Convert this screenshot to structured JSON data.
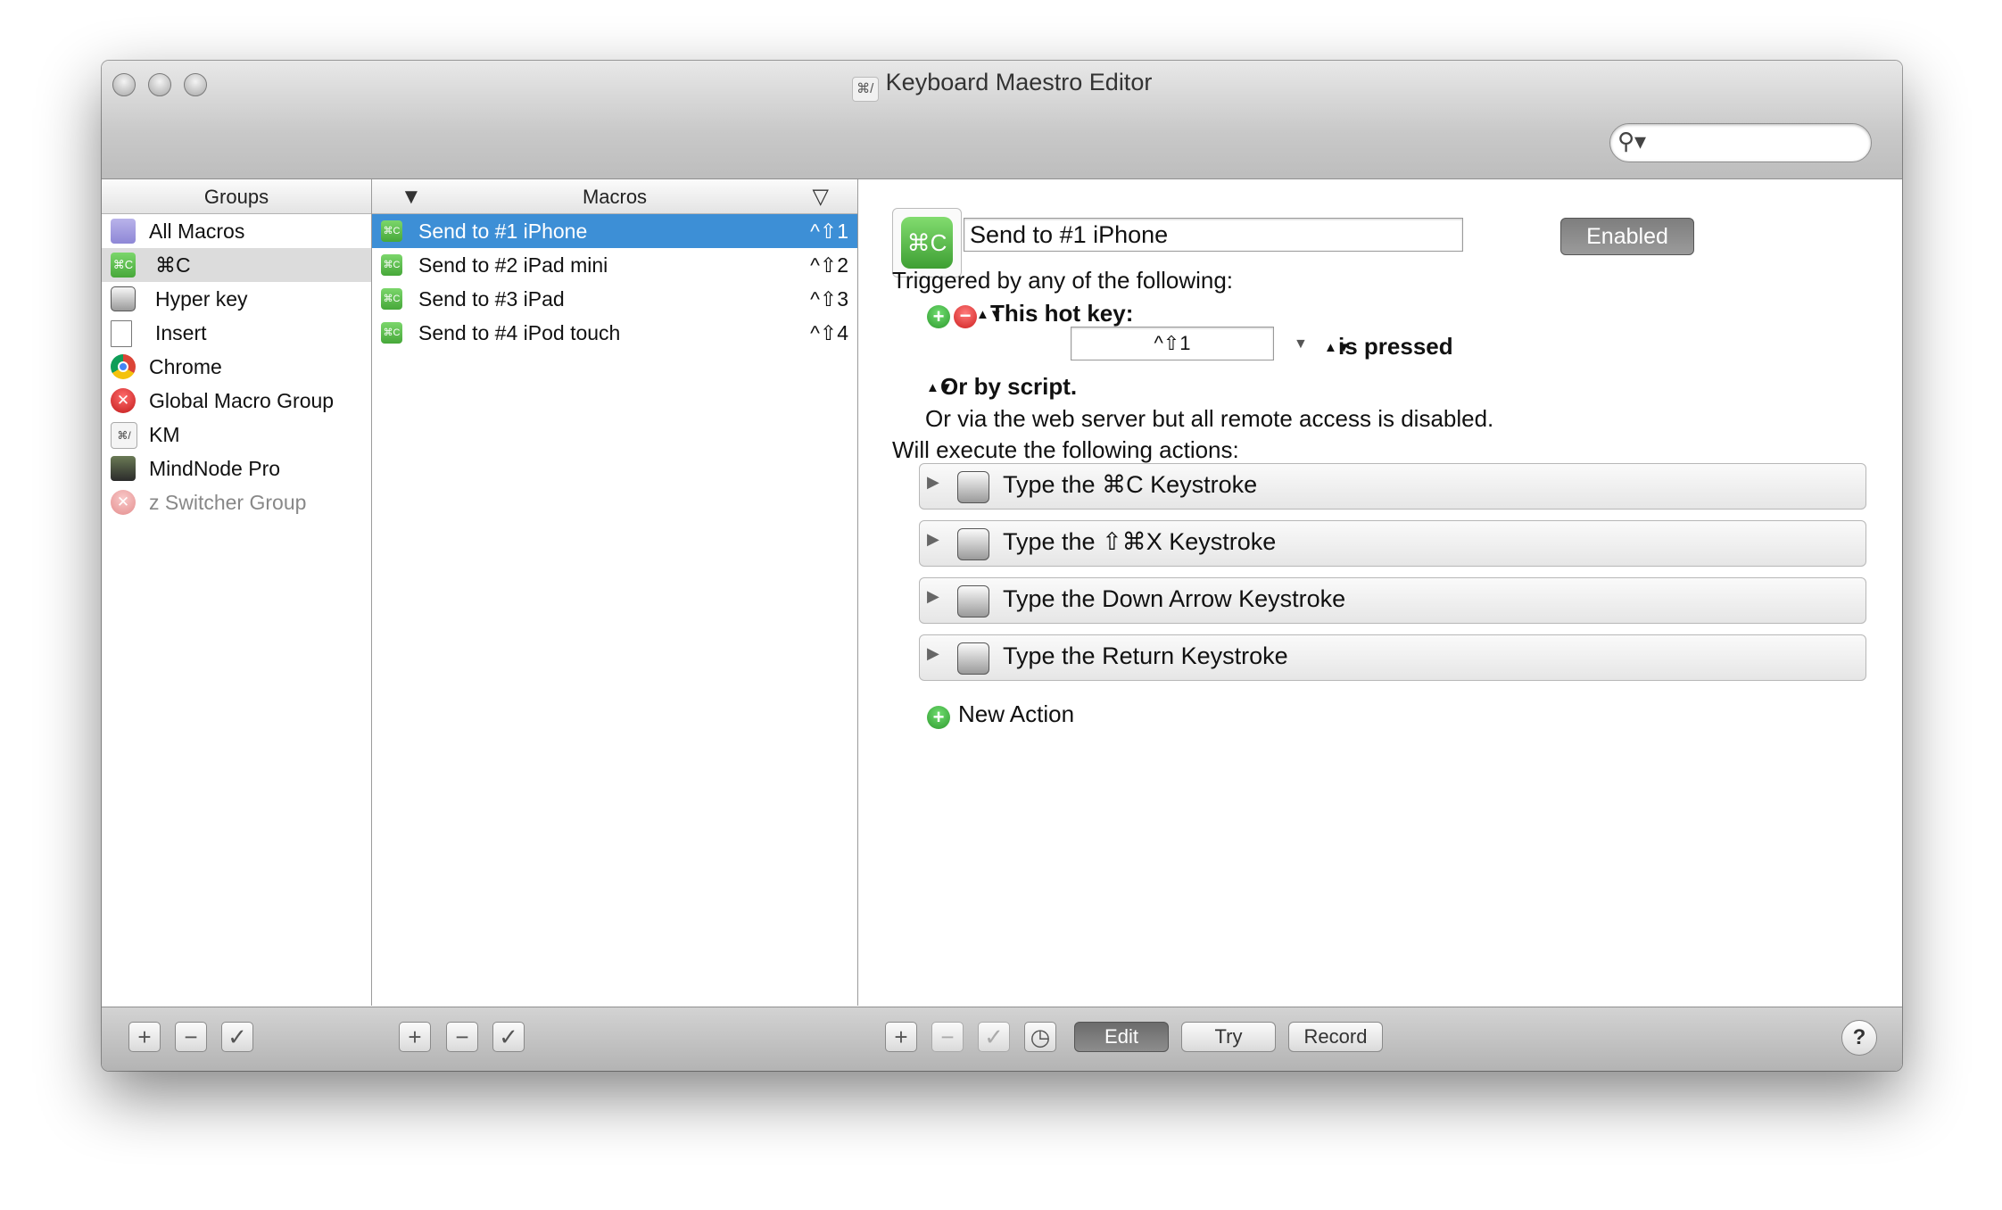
{
  "window": {
    "title": "Keyboard Maestro Editor",
    "title_icon_glyph": "⌘/"
  },
  "search": {
    "placeholder": "",
    "icon_glyph": "⚲▾"
  },
  "groups": {
    "header": "Groups",
    "items": [
      {
        "label": "All Macros",
        "icon": "folder-icon",
        "glyph": ""
      },
      {
        "label": "⌘C",
        "icon": "command-c-icon",
        "glyph": "⌘C",
        "selected": true
      },
      {
        "label": "Hyper key",
        "icon": "keyboard-key-icon",
        "glyph": ""
      },
      {
        "label": "Insert",
        "icon": "document-icon",
        "glyph": ""
      },
      {
        "label": "Chrome",
        "icon": "chrome-icon",
        "glyph": ""
      },
      {
        "label": "Global Macro Group",
        "icon": "disabled-x-icon",
        "glyph": "✕"
      },
      {
        "label": "KM",
        "icon": "keyboard-maestro-icon",
        "glyph": "⌘/"
      },
      {
        "label": "MindNode Pro",
        "icon": "mindnode-icon",
        "glyph": ""
      },
      {
        "label": "z Switcher Group",
        "icon": "disabled-x-icon",
        "glyph": "✕",
        "dimmed": true
      }
    ]
  },
  "macros": {
    "header": "Macros",
    "sort_glyph": "▼",
    "filter_glyph": "▽",
    "items": [
      {
        "label": "Send to #1 iPhone",
        "hotkey": "^⇧1",
        "glyph": "⌘C",
        "selected": true
      },
      {
        "label": "Send to #2 iPad mini",
        "hotkey": "^⇧2",
        "glyph": "⌘C"
      },
      {
        "label": "Send to #3 iPad",
        "hotkey": "^⇧3",
        "glyph": "⌘C"
      },
      {
        "label": "Send to #4 iPod touch",
        "hotkey": "^⇧4",
        "glyph": "⌘C"
      }
    ]
  },
  "editor": {
    "macro_icon_glyph": "⌘C",
    "macro_name": "Send to #1 iPhone",
    "enabled_label": "Enabled",
    "triggered_heading": "Triggered by any of the following:",
    "add_glyph": "+",
    "remove_glyph": "−",
    "updown_glyph": "▲▼",
    "hotkey_label": "This hot key:",
    "hotkey_value": "^⇧1",
    "dropdown_glyph": "▼",
    "pressed_label": "is pressed",
    "script_label": "Or by script.",
    "web_server_text": "Or via the web server but all remote access is disabled.",
    "actions_heading": "Will execute the following actions:",
    "disclosure_glyph": "▶",
    "actions": [
      {
        "label": "Type the ⌘C Keystroke"
      },
      {
        "label": "Type the ⇧⌘X Keystroke"
      },
      {
        "label": "Type the Down Arrow Keystroke"
      },
      {
        "label": "Type the Return Keystroke"
      }
    ],
    "new_action_label": "New Action"
  },
  "footer": {
    "add_glyph": "+",
    "remove_glyph": "−",
    "check_glyph": "✓",
    "clock_glyph": "◷",
    "edit_label": "Edit",
    "try_label": "Try",
    "record_label": "Record",
    "help_glyph": "?"
  },
  "colors": {
    "selection_blue": "#3d8fd6",
    "macro_green": "#47a83a",
    "enabled_gray": "#8a8a8a"
  }
}
